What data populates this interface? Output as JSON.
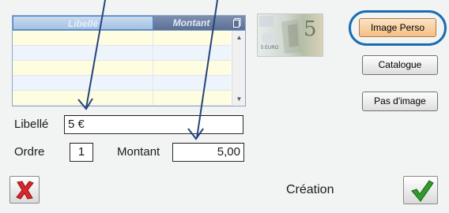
{
  "grid": {
    "columns": {
      "libelle": "Libellé",
      "montant": "Montant"
    },
    "corner_icon": "copy-icon",
    "rows": [
      {
        "libelle": "",
        "montant": ""
      },
      {
        "libelle": "",
        "montant": ""
      },
      {
        "libelle": "",
        "montant": ""
      },
      {
        "libelle": "",
        "montant": ""
      },
      {
        "libelle": "",
        "montant": ""
      }
    ]
  },
  "banknote": {
    "value_text": "5",
    "small_text": "5 EURO"
  },
  "buttons": {
    "image_perso": "Image Perso",
    "catalogue": "Catalogue",
    "pas_image": "Pas d'image"
  },
  "form": {
    "libelle_label": "Libellé",
    "libelle_value": "5 €",
    "ordre_label": "Ordre",
    "ordre_value": "1",
    "montant_label": "Montant",
    "montant_value": "5,00"
  },
  "footer": {
    "cancel_icon": "red-x-icon",
    "status": "Création",
    "confirm_icon": "green-check-icon"
  },
  "colors": {
    "arrow": "#24457a",
    "highlight_ring": "#1a6cb0",
    "cancel_red": "#d8262b",
    "confirm_green": "#2e9b2a"
  }
}
